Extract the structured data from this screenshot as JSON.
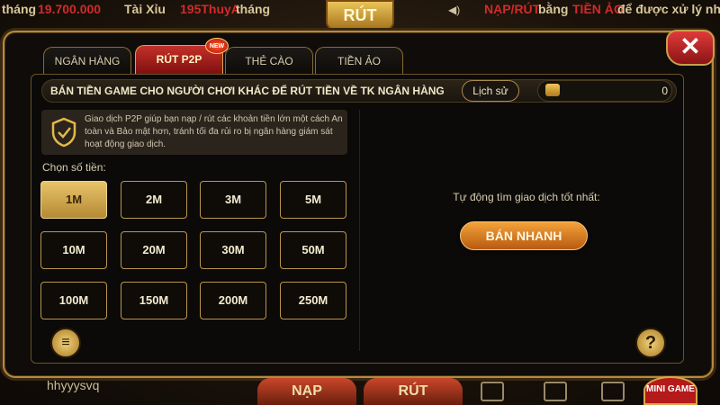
{
  "marquee": {
    "seg1_a": "tháng",
    "seg1_amount": "19.700.000",
    "seg2_a": "Tài Xỉu",
    "seg2_user": "195ThuyA",
    "seg2_b": "tháng",
    "seg3_a": "NẠP/RÚT",
    "seg3_b": "bằng",
    "seg3_c": "TIỀN ẢO",
    "seg3_d": "để được xử lý nhanh"
  },
  "logo_text": "RÚT",
  "tabs": [
    {
      "label": "NGÂN HÀNG",
      "active": false
    },
    {
      "label": "RÚT P2P",
      "active": true
    },
    {
      "label": "THẺ CÀO",
      "active": false
    },
    {
      "label": "TIỀN ẢO",
      "active": false
    }
  ],
  "new_badge": "NEW",
  "close_icon": "close-icon",
  "banner_title": "BÁN TIỀN GAME CHO NGƯỜI CHƠI KHÁC ĐỂ RÚT TIỀN VỀ TK NGÂN HÀNG",
  "history_label": "Lịch sử",
  "balance_value": "0",
  "info_text": "Giao dịch P2P giúp bạn nạp / rút các khoản tiền lớn một cách An toàn và Bảo mật hơn, tránh tối đa rủi ro bị ngân hàng giám sát hoạt động giao dịch.",
  "choose_label": "Chọn số tiền:",
  "amounts": [
    "1M",
    "2M",
    "3M",
    "5M",
    "10M",
    "20M",
    "30M",
    "50M",
    "100M",
    "150M",
    "200M",
    "250M"
  ],
  "selected_amount": "1M",
  "auto_text": "Tự động tìm giao dịch tốt nhất:",
  "sell_button": "BÁN NHANH",
  "doc_icon": "≡",
  "help_icon": "?",
  "footer": {
    "username": "hhyyysvq",
    "nap_label": "NẠP",
    "rut_label": "RÚT",
    "mini_game": "MINI GAME"
  },
  "colors": {
    "accent_gold": "#b8954e",
    "tab_active_red": "#c4302a",
    "sell_orange": "#f3a23a"
  }
}
